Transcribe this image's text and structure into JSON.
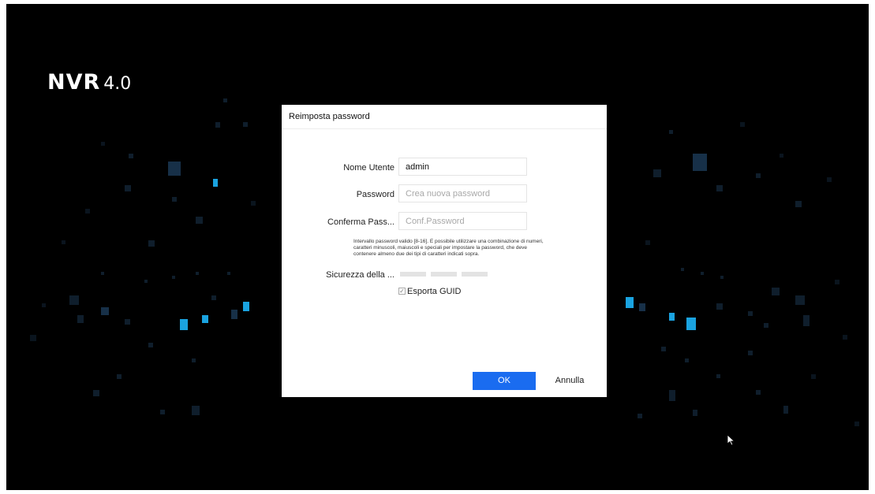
{
  "logo": {
    "brand": "NVR",
    "version": "4.0"
  },
  "dialog": {
    "title": "Reimposta password",
    "username_label": "Nome Utente",
    "username_value": "admin",
    "password_label": "Password",
    "password_placeholder": "Crea nuova password",
    "confirm_label": "Conferma Pass...",
    "confirm_placeholder": "Conf.Password",
    "hint": "Intervallo password valido [8-16]. È possibile utilizzare una combinazione di numeri, caratteri minuscoli, maiuscoli e speciali per impostare la password, che deve contenere almeno due dei tipi di caratteri indicati sopra.",
    "strength_label": "Sicurezza della ...",
    "export_guid_label": "Esporta GUID",
    "export_guid_checked": true,
    "ok_label": "OK",
    "cancel_label": "Annulla"
  },
  "colors": {
    "background": "#000000",
    "accent": "#1a6cf0",
    "highlight_square": "#1aa3e0"
  },
  "icons": {
    "cursor": "mouse-pointer-icon",
    "checkbox": "checkmark-icon"
  }
}
